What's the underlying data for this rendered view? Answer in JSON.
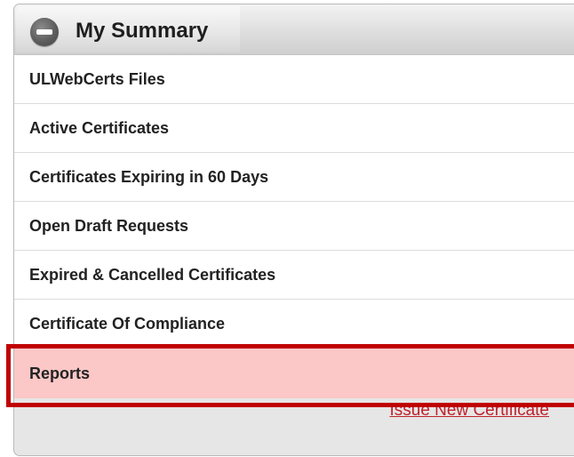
{
  "panel": {
    "title": "My Summary",
    "collapse_icon": "minus-circle-icon"
  },
  "items": [
    {
      "label": "ULWebCerts Files"
    },
    {
      "label": "Active Certificates"
    },
    {
      "label": "Certificates Expiring in 60 Days"
    },
    {
      "label": "Open Draft Requests"
    },
    {
      "label": "Expired & Cancelled Certificates"
    },
    {
      "label": "Certificate Of Compliance"
    },
    {
      "label": "Reports",
      "highlighted": true
    }
  ],
  "footer": {
    "issue_link": "Issue New Certificate"
  },
  "colors": {
    "highlight_fill": "#fcc7c7",
    "highlight_border": "#c00000",
    "link": "#c0222b"
  }
}
